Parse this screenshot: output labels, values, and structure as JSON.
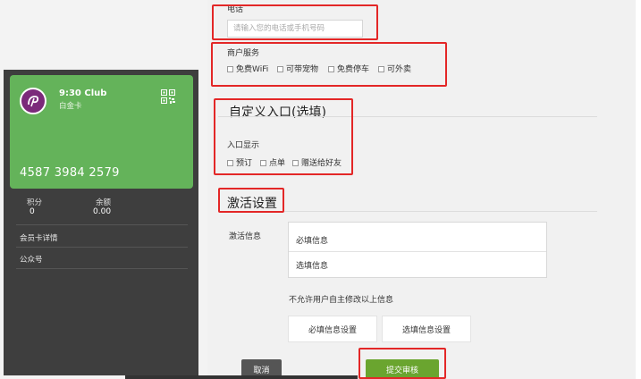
{
  "card": {
    "club_name": "9:30 Club",
    "card_type": "白金卡",
    "card_number": "4587 3984 2579",
    "points_label": "积分",
    "points_value": "0",
    "balance_label": "余额",
    "balance_value": "0.00",
    "menu": [
      "会员卡详情",
      "公众号"
    ]
  },
  "form": {
    "phone_label": "电话",
    "phone_placeholder": "请输入您的电话或手机号码",
    "merchant_services_label": "商户服务",
    "merchant_services": [
      "免费WiFi",
      "可带宠物",
      "免费停车",
      "可外卖"
    ],
    "custom_entry_title": "自定义入口(选填)",
    "entry_display_label": "入口显示",
    "entry_options": [
      "预订",
      "点单",
      "赠送给好友"
    ],
    "activation_title": "激活设置",
    "activation_info_label": "激活信息",
    "required_info": "必填信息",
    "optional_info": "选填信息",
    "no_modify_note": "不允许用户自主修改以上信息",
    "required_settings_button": "必填信息设置",
    "optional_settings_button": "选填信息设置",
    "cancel_button": "取消",
    "submit_button": "提交审核"
  },
  "colors": {
    "card_green": "#64b35a",
    "submit_green": "#6aa52f",
    "highlight_red": "#e32727",
    "panel_dark": "#3e3e3e"
  }
}
